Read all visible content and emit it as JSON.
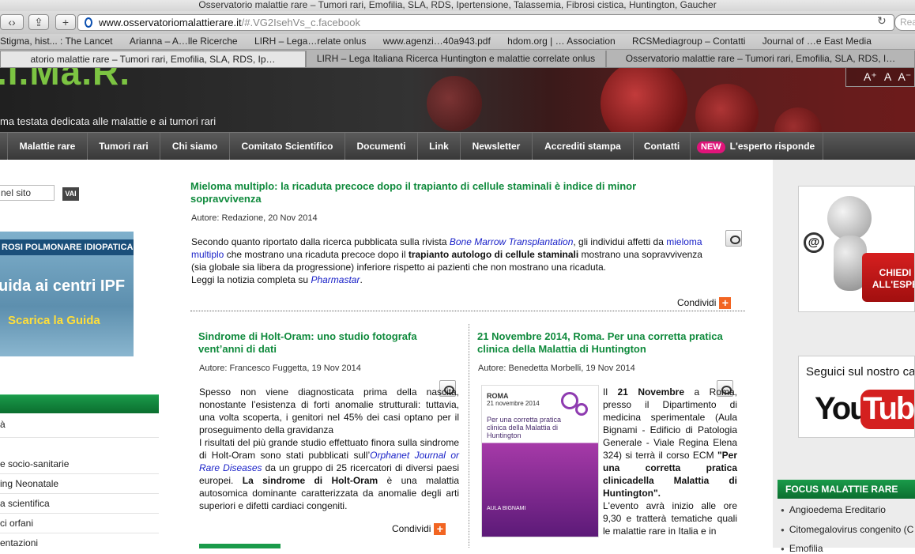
{
  "window": {
    "title": "Osservatorio malattie rare – Tumori rari, Emofilia, SLA, RDS, Ipertensione, Talassemia, Fibrosi cistica, Huntington, Gaucher"
  },
  "toolbar": {
    "url_main": "www.osservatoriomalattierare.it",
    "url_hash": "/#.VG2IsehVs_c.facebook",
    "search_placeholder": "Rea"
  },
  "bookmarks": [
    "Stigma, hist... : The Lancet",
    "Arianna – A…lle Ricerche",
    "LIRH – Lega…relate onlus",
    "www.agenzi…40a943.pdf",
    "hdom.org | … Association",
    "RCSMediagroup – Contatti",
    "Journal of …e East Media"
  ],
  "tabs": [
    "atorio malattie rare – Tumori rari, Emofilia, SLA, RDS, Ip…",
    "LIRH – Lega Italiana Ricerca Huntington e malattie correlate onlus",
    "Osservatorio malattie rare – Tumori rari, Emofilia, SLA, RDS, I…"
  ],
  "header": {
    "logo": ".I.Ma.R.",
    "tagline": "ma testata dedicata alle malattie e ai tumori rari",
    "font_controls": "A⁺ A A⁻"
  },
  "nav": {
    "items": [
      "Malattie rare",
      "Tumori rari",
      "Chi siamo",
      "Comitato Scientifico",
      "Documenti",
      "Link",
      "Newsletter",
      "Accrediti stampa",
      "Contatti"
    ],
    "new_badge": "NEW",
    "expert": "L'esperto risponde"
  },
  "sidebar": {
    "search_value": "nel sito",
    "search_button": "VAI",
    "banner": {
      "band": "ROSI POLMONARE IDIOPATICA",
      "big": "uida ai centri IPF",
      "download": "Scarica la Guida"
    },
    "menu": [
      "à",
      "e socio-sanitarie",
      "ing Neonatale",
      "a scientifica",
      "ci orfani",
      "entazioni"
    ]
  },
  "articles": {
    "a1": {
      "title": "Mieloma multiplo: la ricaduta precoce dopo il trapianto di cellule staminali è indice di minor sopravvivenza",
      "meta": "Autore: Redazione,  20 Nov 2014",
      "p1": "Secondo quanto riportato dalla ricerca pubblicata sulla rivista ",
      "link1": "Bone Marrow Transplantation",
      "p2": ", gli individui affetti da ",
      "link2": "mieloma multiplo",
      "p3": " che mostrano una ricaduta precoce dopo il ",
      "bold1": "trapianto autologo di cellule staminali",
      "p4": " mostrano una sopravvivenza (sia globale sia libera da progressione) inferiore rispetto ai pazienti che non mostrano una ricaduta.",
      "p5": "Leggi la notizia completa su ",
      "link3": "Pharmastar",
      "p6": ".",
      "share": "Condividi"
    },
    "a2": {
      "title": "Sindrome di Holt-Oram: uno studio fotografa vent’anni di dati",
      "meta": "Autore: Francesco Fuggetta,  19 Nov 2014",
      "p1": "Spesso non viene diagnosticata prima della nascita, nonostante l’esistenza di forti anomalie strutturali: tuttavia, una volta scoperta, i genitori nel 45% dei casi optano per il proseguimento della gravidanza",
      "p2": "I risultati del più grande studio effettuato finora sulla sindrome di Holt-Oram sono stati pubblicati sull’",
      "link1": "Orphanet Journal or Rare Diseases",
      "p3": " da un gruppo di 25 ricercatori di diversi paesi europei. ",
      "bold1": "La sindrome di Holt-Oram",
      "p4": " è una malattia autosomica dominante caratterizzata da anomalie degli arti superiori e difetti cardiaci congeniti.",
      "share": "Condividi"
    },
    "a3": {
      "title": "21 Novembre 2014, Roma. Per una corretta pratica clinica della Malattia di Huntington",
      "meta": "Autore: Benedetta Morbelli,  19 Nov 2014",
      "p1": "Il ",
      "bold1": "21 Novembre",
      "p2": " a Roma, presso il Dipartimento di medicina sperimentale (Aula Bignami - Edificio di Patologia Generale - Viale Regina Elena 324) si terrà il corso ECM ",
      "bold2": "\"Per una corretta pratica clinicadella Malattia di Huntington\".",
      "p3": "L'evento avrà inizio alle ore 9,30 e tratterà tematiche quali le malattie rare in Italia e in",
      "poster": {
        "city": "ROMA",
        "date": "21 novembre 2014",
        "title": "Per una corretta pratica clinica della Malattia di Huntington",
        "aula": "AULA BIGNAMI"
      }
    }
  },
  "right": {
    "chiedi": "CHIEDI ALL'ESPE",
    "youtube_seg": "Seguici sul nostro can",
    "you": "You",
    "tube": "Tube",
    "focus_title": "FOCUS MALATTIE RARE",
    "focus_items": [
      "Angioedema Ereditario",
      "Citomegalovirus congenito (C",
      "Emofilia"
    ]
  }
}
